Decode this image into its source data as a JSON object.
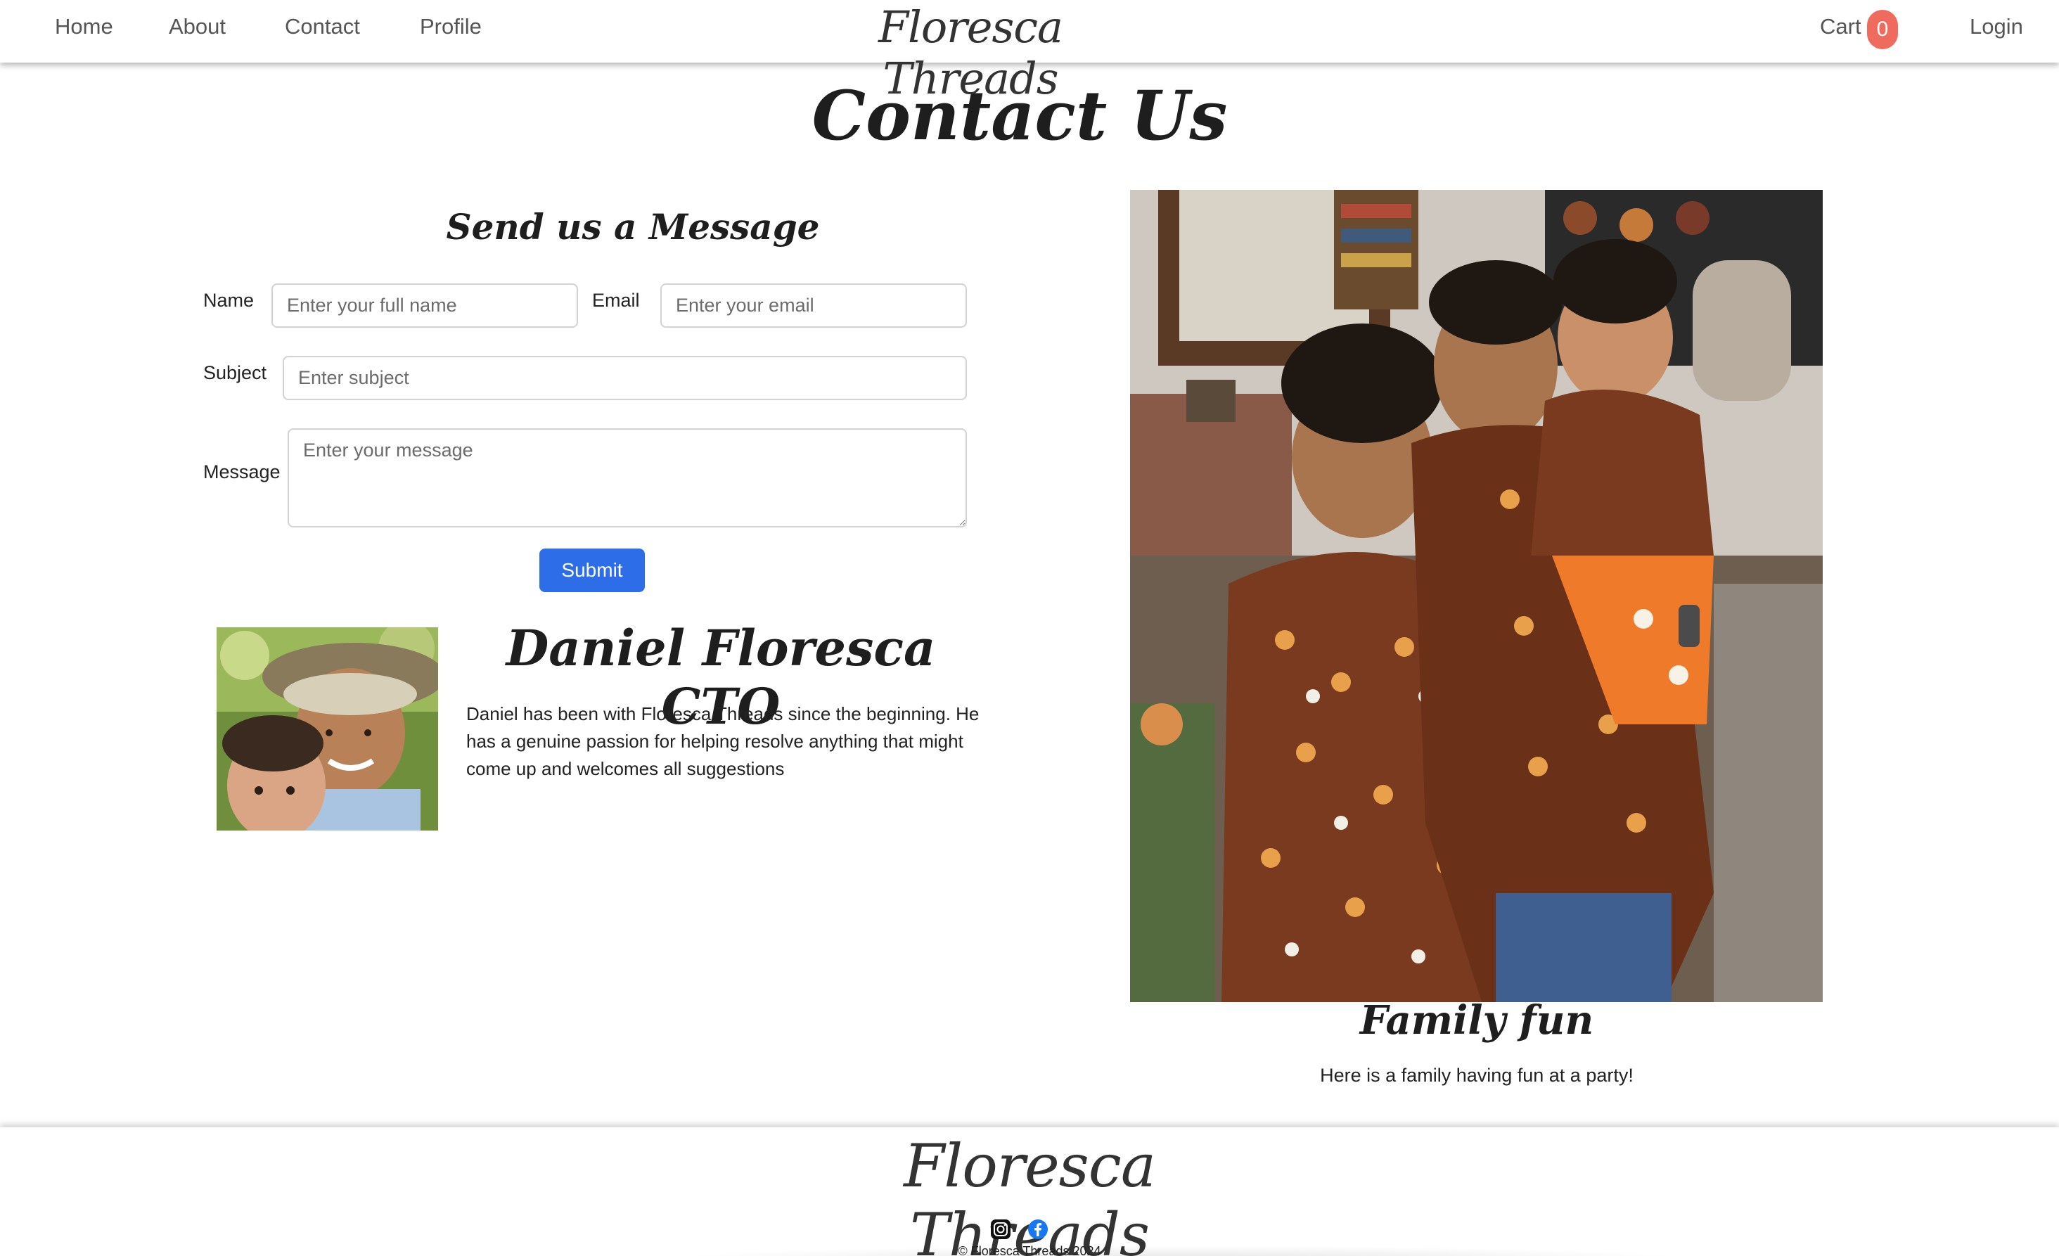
{
  "nav": {
    "home": "Home",
    "about": "About",
    "contact": "Contact",
    "profile": "Profile",
    "brand": "Floresca Threads",
    "cart": "Cart",
    "cart_count": "0",
    "login": "Login"
  },
  "page": {
    "title": "Contact Us"
  },
  "form": {
    "title": "Send us a Message",
    "name_label": "Name",
    "name_placeholder": "Enter your full name",
    "email_label": "Email",
    "email_placeholder": "Enter your email",
    "subject_label": "Subject",
    "subject_placeholder": "Enter subject",
    "message_label": "Message",
    "message_placeholder": "Enter your message",
    "submit_label": "Submit"
  },
  "profile": {
    "name": "Daniel Floresca CTO",
    "bio": "Daniel has been with Floresca Threads since the beginning. He has a genuine passion for helping resolve anything that might come up and welcomes all suggestions"
  },
  "family": {
    "caption": "Family fun",
    "text": "Here is a family having fun at a party!"
  },
  "footer": {
    "brand": "Floresca Threads",
    "copyright": "© Floresca Threads 2024",
    "icons": [
      "instagram-icon",
      "facebook-icon"
    ]
  },
  "colors": {
    "accent": "#2d6ee8",
    "cart_badge": "#ef6b5e"
  }
}
